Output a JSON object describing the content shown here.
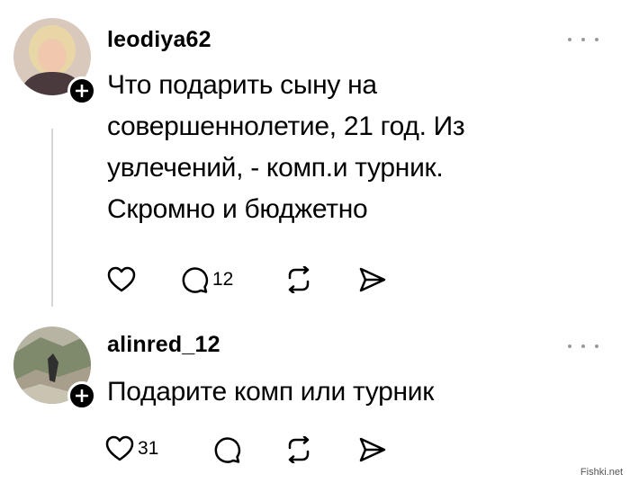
{
  "posts": [
    {
      "username": "leodiya62",
      "text": "Что подарить сыну на совершеннолетие, 21 год. Из увлечений, - комп.и турник. Скромно и бюджетно",
      "text_lines": [
        "Что подарить сыну на",
        "совершеннолетие, 21 год. Из",
        "увлечений, - комп.и турник.",
        "Скромно и бюджетно"
      ],
      "avatar_icon": "user-photo-woman",
      "likes": "",
      "replies": "12",
      "icons": [
        "heart-icon",
        "comment-icon",
        "repost-icon",
        "share-icon"
      ]
    },
    {
      "username": "alinred_12",
      "text": "Подарите комп или турник",
      "text_lines": [
        "Подарите комп или турник"
      ],
      "avatar_icon": "user-photo-landscape",
      "likes": "31",
      "replies": "",
      "icons": [
        "heart-icon",
        "comment-icon",
        "repost-icon",
        "share-icon"
      ]
    }
  ],
  "watermark": "Fishki.net",
  "colors": {
    "background": "#ffffff",
    "text": "#000000",
    "thread_line": "#d6d6d6",
    "more_dots": "#9a9a9a"
  }
}
